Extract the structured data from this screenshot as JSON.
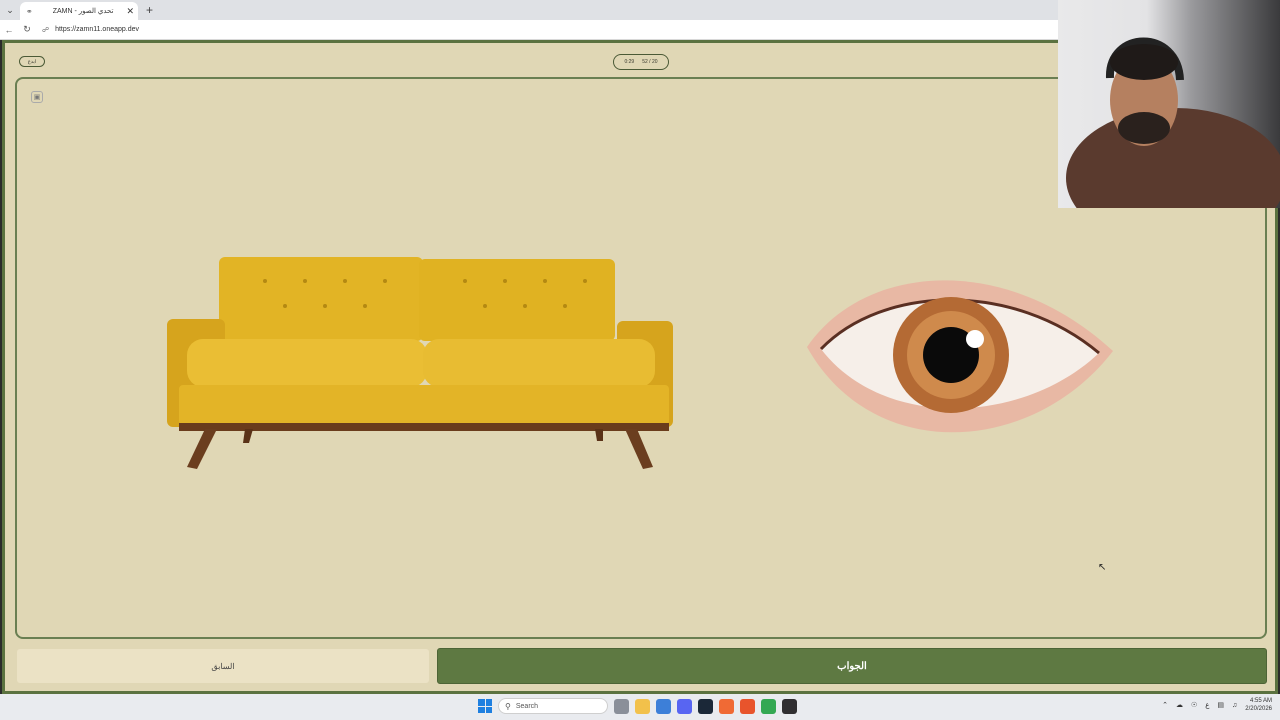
{
  "browser": {
    "tab_title": "ZAMN - تحدي الصور",
    "url": "https://zamn11.oneapp.dev",
    "icons": [
      "tab-list-icon",
      "globe-icon",
      "close-icon",
      "new-tab-icon",
      "back-icon",
      "reload-icon",
      "site-info-icon"
    ]
  },
  "game": {
    "top_left_pill": "ابدع",
    "timer": "0:29",
    "progress": "52 / 20",
    "images": [
      "sofa-image",
      "eye-image"
    ],
    "prev_label": "السابق",
    "answer_label": "الجواب"
  },
  "taskbar": {
    "search_placeholder": "Search",
    "time": "4:55 AM",
    "date": "2/20/2026",
    "lang": "ع"
  },
  "colors": {
    "bg": "#e0d7b5",
    "accent": "#5e7942",
    "border": "#5b7240"
  }
}
